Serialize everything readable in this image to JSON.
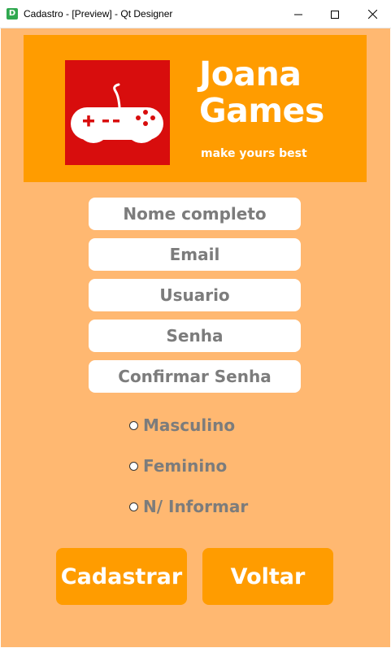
{
  "window": {
    "icon_letter": "D",
    "title": "Cadastro - [Preview] - Qt Designer"
  },
  "banner": {
    "brand_line1": "Joana",
    "brand_line2": "Games",
    "tagline": "make yours best",
    "logo_icon": "gamepad-icon"
  },
  "form": {
    "fields": [
      {
        "placeholder": "Nome completo"
      },
      {
        "placeholder": "Email"
      },
      {
        "placeholder": "Usuario"
      },
      {
        "placeholder": "Senha"
      },
      {
        "placeholder": "Confirmar Senha"
      }
    ],
    "gender_options": [
      "Masculino",
      "Feminino",
      "N/ Informar"
    ]
  },
  "buttons": {
    "register": "Cadastrar",
    "back": "Voltar"
  },
  "colors": {
    "background": "#ffb871",
    "accent": "#ff9c00",
    "logo_red": "#d80d0d",
    "text_gray": "#7c7c7c"
  }
}
